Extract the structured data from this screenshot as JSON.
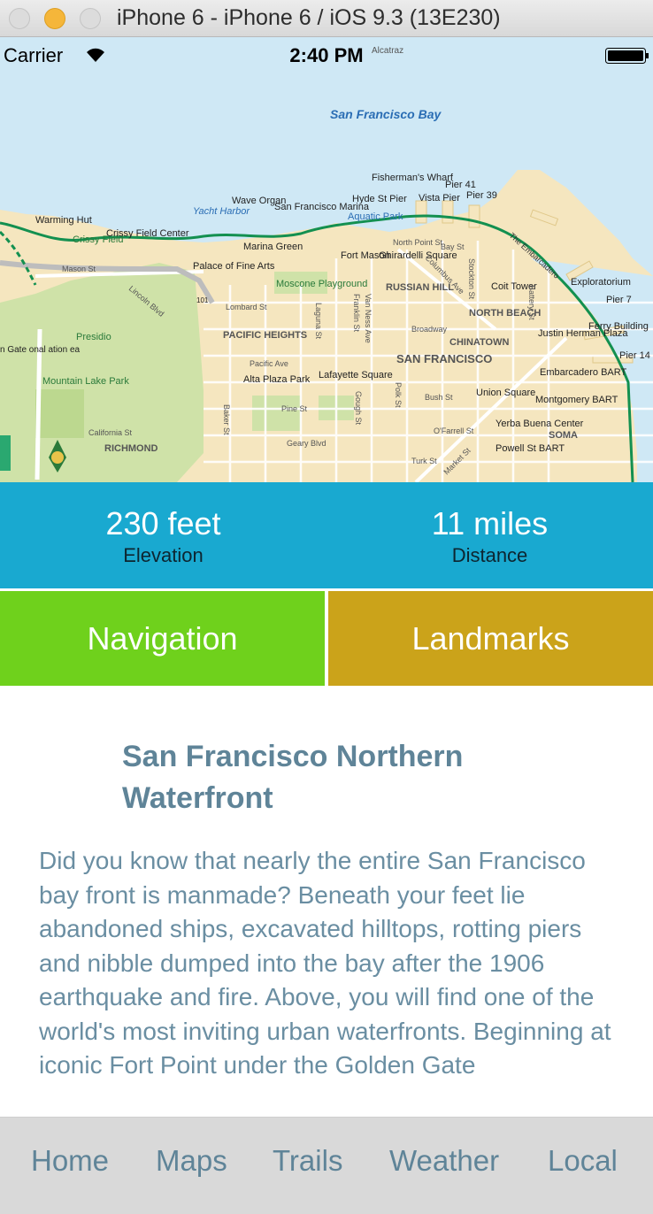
{
  "window": {
    "title": "iPhone 6 - iPhone 6 / iOS 9.3 (13E230)"
  },
  "status_bar": {
    "carrier": "Carrier",
    "time": "2:40 PM"
  },
  "map": {
    "labels": {
      "bay": "San Francisco Bay",
      "alcatraz": "Alcatraz",
      "fishermans_wharf": "Fisherman's Wharf",
      "hyde_st_pier": "Hyde St Pier",
      "vista_pier": "Vista Pier",
      "pier41": "Pier 41",
      "pier39": "Pier 39",
      "wave_organ": "Wave Organ",
      "sf_marina": "San Francisco Marina",
      "aquatic_park": "Aquatic Park",
      "yacht_harbor": "Yacht Harbor",
      "warming_hut": "Warming Hut",
      "crissy_field": "Crissy Field",
      "crissy_field_center": "Crissy Field Center",
      "marina_green": "Marina Green",
      "fort_mason": "Fort Mason",
      "ghirardelli": "Ghirardelli Square",
      "palace": "Palace of Fine Arts",
      "moscone": "Moscone Playground",
      "russian_hill": "RUSSIAN HILL",
      "north_beach": "NORTH BEACH",
      "coit_tower": "Coit Tower",
      "exploratorium": "Exploratorium",
      "pier7": "Pier 7",
      "ferry_building": "Ferry Building",
      "pier14": "Pier 14",
      "presidio": "Presidio",
      "pacific_heights": "PACIFIC HEIGHTS",
      "chinatown": "CHINATOWN",
      "san_francisco": "SAN FRANCISCO",
      "justin_herman": "Justin Herman Plaza",
      "embarcadero_bart": "Embarcadero BART",
      "mountain_lake": "Mountain Lake Park",
      "alta_plaza": "Alta Plaza Park",
      "lafayette": "Lafayette Square",
      "union_square": "Union Square",
      "montgomery_bart": "Montgomery BART",
      "yerba_buena": "Yerba Buena Center",
      "soma": "SOMA",
      "powell_bart": "Powell St BART",
      "richmond": "RICHMOND",
      "the_embarcadero": "The Embarcadero",
      "lombard": "Lombard St",
      "broadway": "Broadway",
      "pacific_ave": "Pacific Ave",
      "california_st": "California St",
      "geary": "Geary Blvd",
      "pine_st": "Pine St",
      "bush_st": "Bush St",
      "ofarrell": "O'Farrell St",
      "turk_st": "Turk St",
      "market_st": "Market St",
      "north_point": "North Point St",
      "bay_st": "Bay St",
      "mason_st": "Mason St",
      "lincoln_blvd": "Lincoln Blvd",
      "columbus_ave": "Columbus Ave",
      "stockton_st": "Stockton St",
      "battery_st": "Battery St",
      "laguna_st": "Laguna St",
      "van_ness": "Van Ness Ave",
      "franklin_st": "Franklin St",
      "polk_st": "Polk St",
      "gough_st": "Gough St",
      "baker_st": "Baker St",
      "golden_gate_edge": "n Gate onal ation ea",
      "route_101": "101"
    }
  },
  "stats": {
    "elevation_value": "230 feet",
    "elevation_label": "Elevation",
    "distance_value": "11 miles",
    "distance_label": "Distance"
  },
  "buttons": {
    "navigation": "Navigation",
    "landmarks": "Landmarks"
  },
  "content": {
    "title": "San Francisco Northern Waterfront",
    "body": "Did you know that nearly the entire San Francisco bay front is manmade? Beneath your feet lie abandoned ships, excavated hilltops, rotting piers and nibble dumped into the bay after the 1906 earthquake and fire. Above, you will find one of the world's most inviting urban waterfronts. Beginning at iconic Fort Point under the Golden Gate"
  },
  "tabs": [
    "Home",
    "Maps",
    "Trails",
    "Weather",
    "Local"
  ],
  "colors": {
    "stats_bg": "#19a9d0",
    "navigation_bg": "#6fd11c",
    "landmarks_bg": "#cba31a",
    "text_slate": "#5f8498",
    "tabbar_bg": "#d9d9d9"
  }
}
